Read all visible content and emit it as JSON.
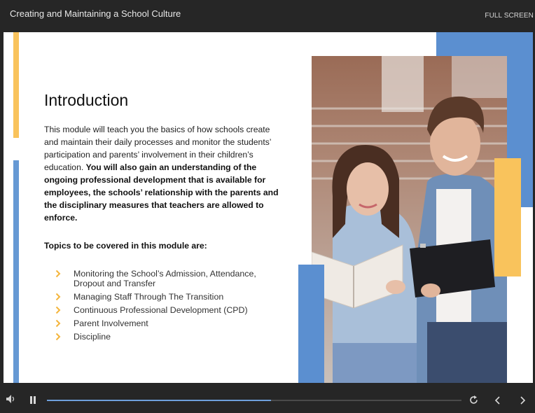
{
  "header": {
    "course_title": "Creating and Maintaining a School Culture",
    "fullscreen_label": "FULL SCREEN"
  },
  "slide": {
    "heading": "Introduction",
    "intro_plain": "This module will teach you the basics of how schools create and maintain their daily processes and monitor the students’ participation and parents’ involvement in their children’s education. ",
    "intro_bold": "You will also gain an understanding of the ongoing professional development that is available for employees, the schools’ relationship with the parents and the disciplinary measures that teachers are allowed to enforce.",
    "topics_title": "Topics to be covered in this module are:",
    "topics": [
      "Monitoring the School’s Admission, Attendance, Dropout and Transfer",
      "Managing Staff Through The Transition",
      "Continuous Professional Development (CPD)",
      "Parent Involvement",
      "Discipline"
    ]
  },
  "player": {
    "progress": 0.54,
    "icons": [
      "volume-icon",
      "pause-icon",
      "replay-icon",
      "previous-icon",
      "next-icon"
    ]
  },
  "colors": {
    "accent_yellow": "#f9c35c",
    "accent_blue": "#5b8fd0",
    "progress": "#6ea0dc",
    "chrome": "#262626"
  }
}
